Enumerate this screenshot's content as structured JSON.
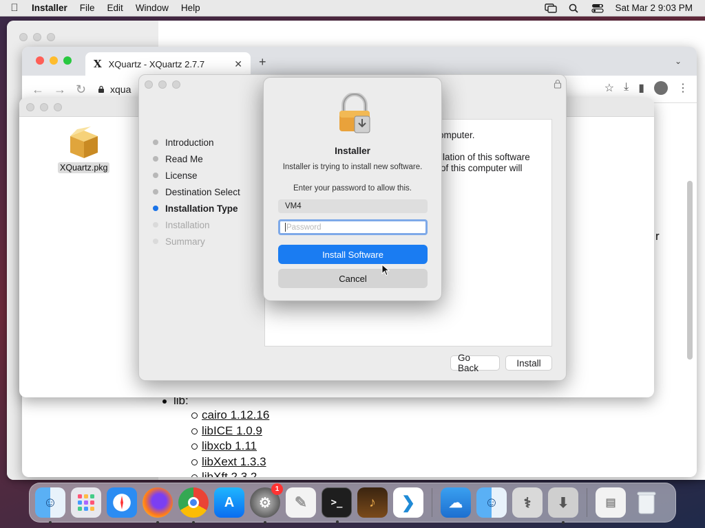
{
  "menubar": {
    "app_name": "Installer",
    "menus": [
      "File",
      "Edit",
      "Window",
      "Help"
    ],
    "datetime": "Sat Mar 2  9:03 PM",
    "icons": [
      "apple-icon",
      "screen-mirroring-icon",
      "spotlight-search-icon",
      "control-center-icon"
    ]
  },
  "browser": {
    "tab_title": "XQuartz - XQuartz 2.7.7",
    "url_partial": "xqua",
    "page_list_heading": "lib:",
    "page_list_items": [
      "cairo 1.12.16",
      "libICE 1.0.9",
      "libxcb 1.11",
      "libXext 1.3.3",
      "libXft 2.3.2"
    ],
    "edge_char": "r"
  },
  "finder": {
    "file_label": "XQuartz.pkg"
  },
  "installer": {
    "steps": [
      {
        "label": "Introduction",
        "state": "done"
      },
      {
        "label": "Read Me",
        "state": "done"
      },
      {
        "label": "License",
        "state": "done"
      },
      {
        "label": "Destination Select",
        "state": "done"
      },
      {
        "label": "Installation Type",
        "state": "active"
      },
      {
        "label": "Installation",
        "state": "pending"
      },
      {
        "label": "Summary",
        "state": "pending"
      }
    ],
    "content_line1": "r computer.",
    "content_line2": "llation of this software",
    "content_line3": "of this computer will",
    "go_back_label": "Go Back",
    "install_label": "Install"
  },
  "auth_dialog": {
    "title": "Installer",
    "message": "Installer is trying to install new software.",
    "prompt": "Enter your password to allow this.",
    "username": "VM4",
    "password_placeholder": "Password",
    "primary_button": "Install Software",
    "cancel_button": "Cancel",
    "focus_color": "#7ea9e8",
    "primary_color": "#1a7cf2"
  },
  "dock": {
    "apps": [
      "Finder",
      "Launchpad",
      "Safari",
      "Firefox",
      "Chrome",
      "App Store",
      "System Preferences",
      "TextEdit",
      "Terminal",
      "GarageBand",
      "Visual Studio Code"
    ],
    "system_prefs_badge": "1",
    "recent": [
      "Weather",
      "Finder Helper",
      "Disk Utility",
      "Installer"
    ],
    "trash": "Trash"
  }
}
